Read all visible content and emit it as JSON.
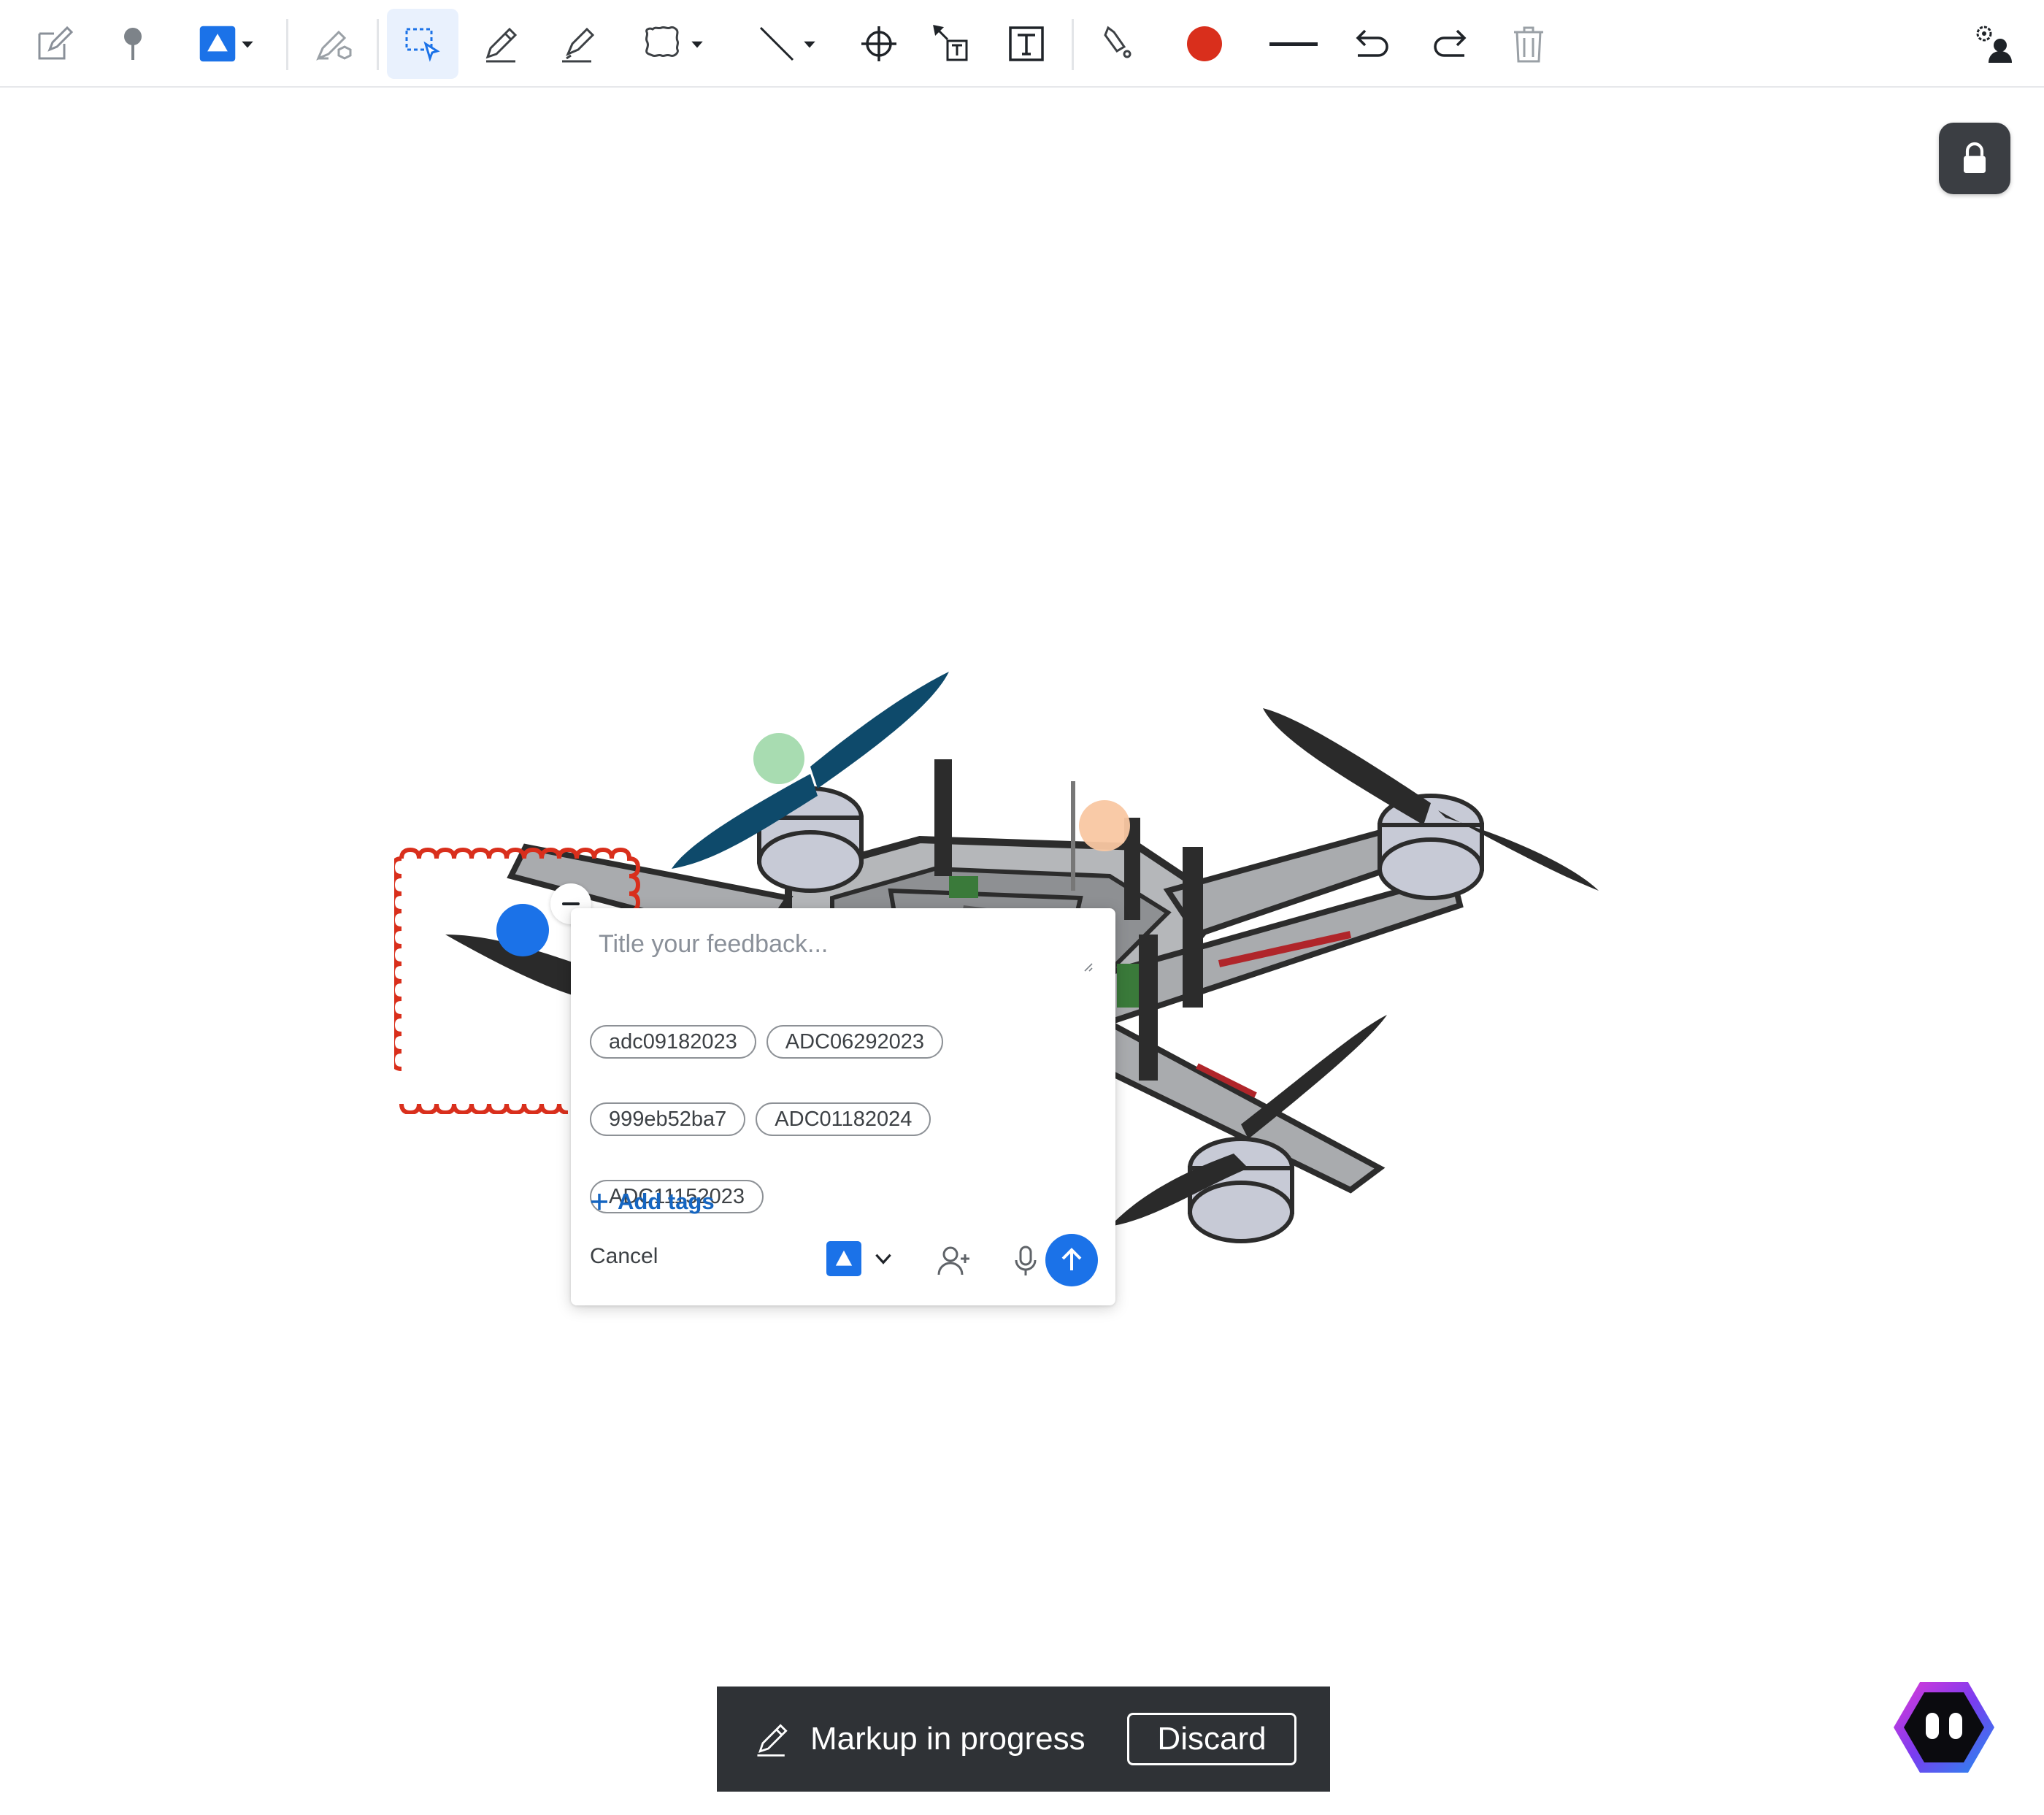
{
  "toolbar": {
    "tools": [
      {
        "id": "edit",
        "icon": "edit-note-icon"
      },
      {
        "id": "pin",
        "icon": "pin-icon"
      },
      {
        "id": "feedback-type",
        "icon": "triangle-badge-icon",
        "dropdown": true
      },
      {
        "id": "draw-3d",
        "icon": "pen-3d-icon"
      },
      {
        "id": "select",
        "icon": "select-area-icon",
        "active": true
      },
      {
        "id": "pencil",
        "icon": "pencil-icon"
      },
      {
        "id": "highlighter",
        "icon": "highlighter-icon"
      },
      {
        "id": "shape",
        "icon": "cloud-shape-icon",
        "dropdown": true
      },
      {
        "id": "line",
        "icon": "line-icon",
        "dropdown": true
      },
      {
        "id": "crosshair",
        "icon": "crosshair-icon"
      },
      {
        "id": "arrow-text",
        "icon": "arrow-text-icon"
      },
      {
        "id": "text",
        "icon": "text-box-icon"
      },
      {
        "id": "fill",
        "icon": "fill-icon"
      },
      {
        "id": "color",
        "icon": "color-swatch-icon",
        "color": "#d92f1c"
      },
      {
        "id": "stroke",
        "icon": "stroke-width-icon"
      },
      {
        "id": "undo",
        "icon": "undo-icon"
      },
      {
        "id": "redo",
        "icon": "redo-icon"
      },
      {
        "id": "delete",
        "icon": "trash-icon"
      },
      {
        "id": "user-settings",
        "icon": "user-settings-icon"
      }
    ]
  },
  "colors": {
    "accent": "#1b72e8",
    "markup_red": "#d92f1c",
    "banner_bg": "#2f3236",
    "pin_green": "#9ed8a8",
    "pin_orange": "#f9c7a2",
    "propeller_blue": "#0e4a6b"
  },
  "feedback": {
    "title_placeholder": "Title your feedback...",
    "title_value": "",
    "tags": [
      "adc09182023",
      "ADC06292023",
      "999eb52ba7",
      "ADC01182024",
      "ADC11152023"
    ],
    "add_tags_label": "Add tags",
    "cancel_label": "Cancel"
  },
  "banner": {
    "text": "Markup in progress",
    "discard_label": "Discard"
  }
}
